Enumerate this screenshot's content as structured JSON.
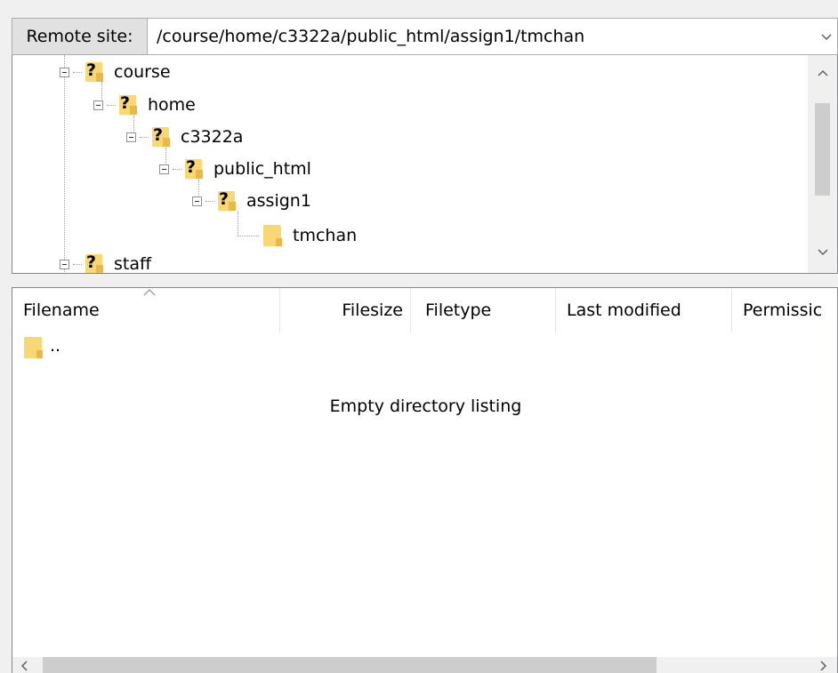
{
  "address": {
    "label": "Remote site:",
    "path": "/course/home/c3322a/public_html/assign1/tmchan"
  },
  "tree": {
    "nodes": [
      {
        "label": "course",
        "expanded": true,
        "icon": "unknown-folder-icon"
      },
      {
        "label": "home",
        "expanded": true,
        "icon": "unknown-folder-icon"
      },
      {
        "label": "c3322a",
        "expanded": true,
        "icon": "unknown-folder-icon"
      },
      {
        "label": "public_html",
        "expanded": true,
        "icon": "unknown-folder-icon"
      },
      {
        "label": "assign1",
        "expanded": true,
        "icon": "unknown-folder-icon"
      },
      {
        "label": "tmchan",
        "expanded": false,
        "icon": "folder-icon"
      },
      {
        "label": "staff",
        "expanded": true,
        "icon": "unknown-folder-icon"
      }
    ]
  },
  "list": {
    "columns": {
      "filename": "Filename",
      "filesize": "Filesize",
      "filetype": "Filetype",
      "last_modified": "Last modified",
      "permissions": "Permissic"
    },
    "parent_entry": "..",
    "empty_message": "Empty directory listing"
  },
  "colors": {
    "folder": "#f8d775",
    "folder_shadow": "#e8b948",
    "scroll_thumb": "#cdcdcd",
    "border": "#828790"
  }
}
